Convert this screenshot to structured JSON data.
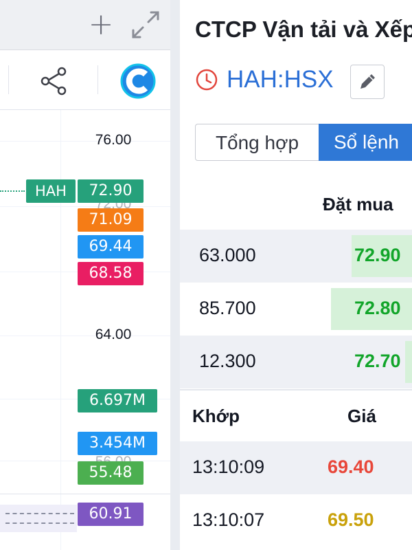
{
  "chart": {
    "axis_labels": [
      "76.00",
      "64.00"
    ],
    "overlapped_labels": [
      "72.00",
      "56.00"
    ],
    "symbol_tag": "HAH",
    "price_tags": [
      {
        "label": "72.90",
        "color": "#26a17b"
      },
      {
        "label": "71.09",
        "color": "#f57c16"
      },
      {
        "label": "69.44",
        "color": "#2196f3"
      },
      {
        "label": "68.58",
        "color": "#e91e63"
      }
    ],
    "volume_tags": [
      {
        "label": "6.697M",
        "color": "#26a17b"
      },
      {
        "label": "3.454M",
        "color": "#2196f3"
      }
    ],
    "lower_tags": [
      {
        "label": "55.48",
        "color": "#4caf50"
      },
      {
        "label": "60.91",
        "color": "#7e57c2"
      }
    ]
  },
  "stock": {
    "company_name": "CTCP Vận tải và Xếp dỡ Hải An",
    "ticker": "HAH:HSX"
  },
  "tabs": [
    {
      "label": "Tổng hợp",
      "active": false
    },
    {
      "label": "Sổ lệnh",
      "active": true
    }
  ],
  "order_book": {
    "bid_header": "Đặt mua",
    "rows": [
      {
        "qty": "63.000",
        "price": "72.90",
        "bar_fraction": 0.26
      },
      {
        "qty": "85.700",
        "price": "72.80",
        "bar_fraction": 0.35
      },
      {
        "qty": "12.300",
        "price": "72.70",
        "bar_fraction": 0.03
      }
    ]
  },
  "trades": {
    "headers": {
      "time": "Khớp",
      "price": "Giá"
    },
    "rows": [
      {
        "time": "13:10:09",
        "price": "69.40",
        "color": "#e8473a"
      },
      {
        "time": "13:10:07",
        "price": "69.50",
        "color": "#c9a10a"
      }
    ]
  },
  "colors": {
    "accent": "#2f78d6",
    "ticker": "#2b6fd6",
    "up": "#12a52a"
  }
}
